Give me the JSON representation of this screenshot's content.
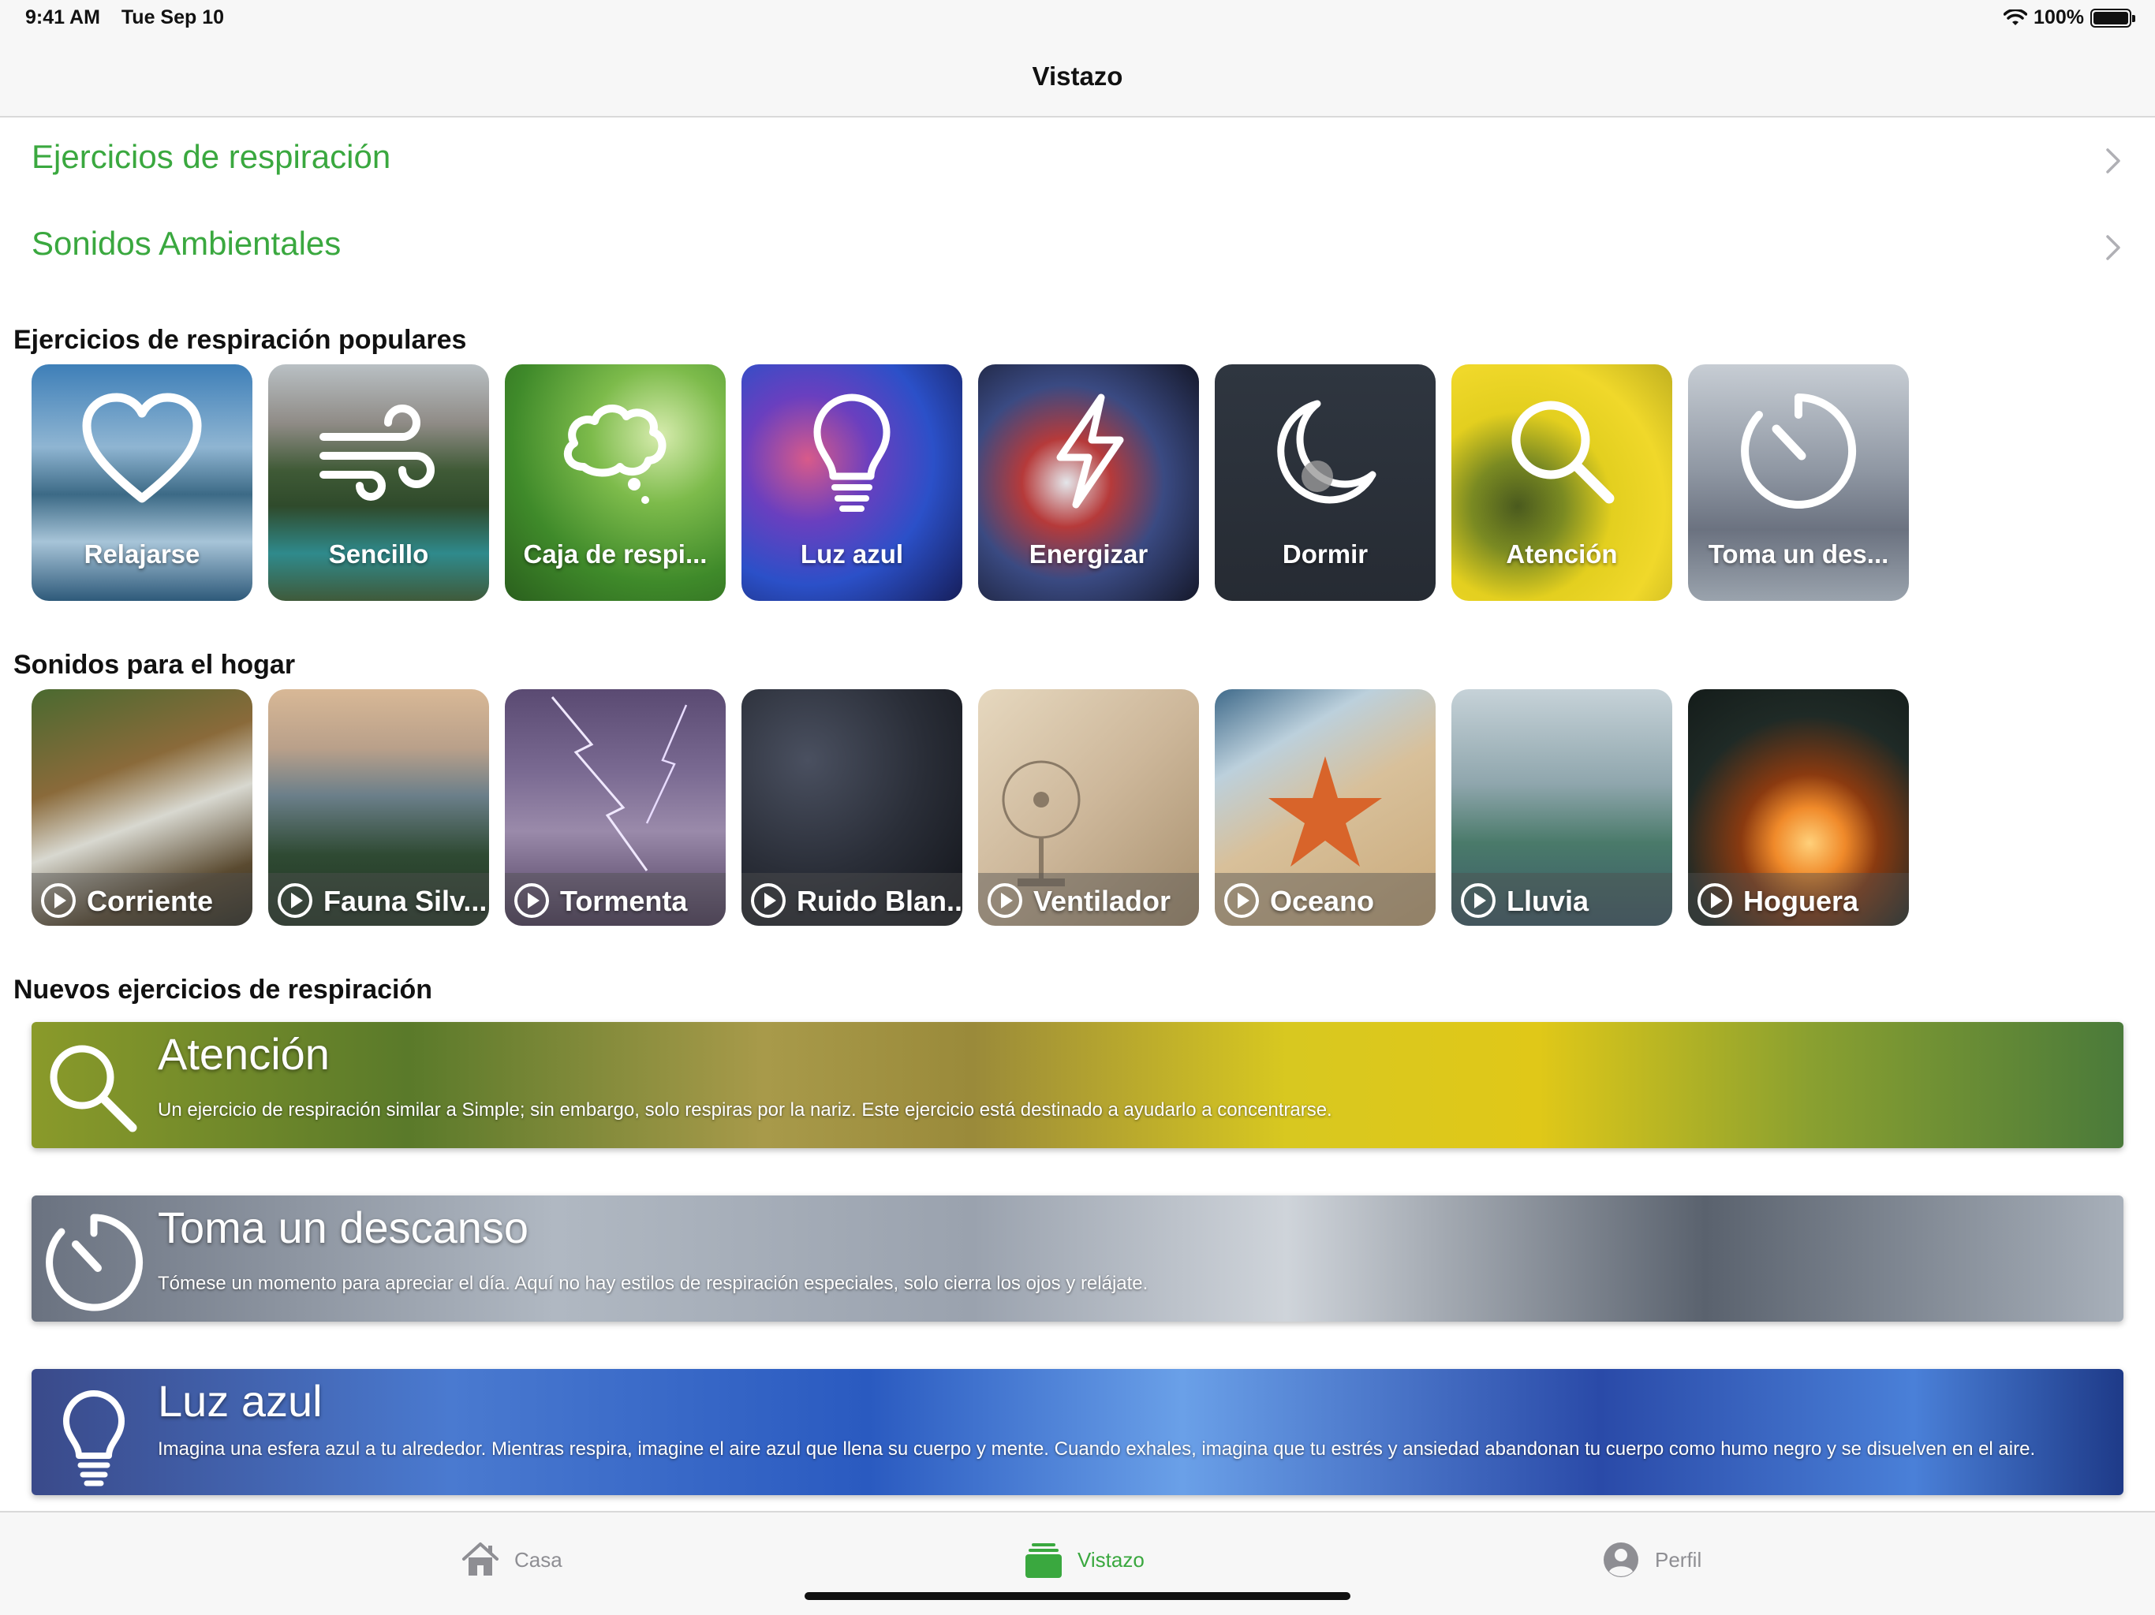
{
  "status_bar": {
    "time": "9:41 AM",
    "date": "Tue Sep 10",
    "battery": "100%"
  },
  "nav": {
    "title": "Vistazo"
  },
  "links": [
    {
      "label": "Ejercicios de respiración"
    },
    {
      "label": "Sonidos Ambientales"
    }
  ],
  "popular": {
    "title": "Ejercicios de respiración populares",
    "items": [
      {
        "label": "Relajarse",
        "icon": "heart-icon"
      },
      {
        "label": "Sencillo",
        "icon": "wind-icon"
      },
      {
        "label": "Caja de respi...",
        "icon": "thought-bubble-icon"
      },
      {
        "label": "Luz azul",
        "icon": "lightbulb-icon"
      },
      {
        "label": "Energizar",
        "icon": "lightning-icon"
      },
      {
        "label": "Dormir",
        "icon": "moon-icon"
      },
      {
        "label": "Atención",
        "icon": "magnifier-icon"
      },
      {
        "label": "Toma un des...",
        "icon": "timer-icon"
      }
    ]
  },
  "sounds": {
    "title": "Sonidos para el hogar",
    "items": [
      {
        "label": "Corriente"
      },
      {
        "label": "Fauna Silv..."
      },
      {
        "label": "Tormenta"
      },
      {
        "label": "Ruido Blan..."
      },
      {
        "label": "Ventilador"
      },
      {
        "label": "Oceano"
      },
      {
        "label": "Lluvia"
      },
      {
        "label": "Hoguera"
      }
    ]
  },
  "new_exercises": {
    "title": "Nuevos ejercicios de respiración",
    "items": [
      {
        "title": "Atención",
        "icon": "magnifier-icon",
        "description": "Un ejercicio de respiración similar a Simple; sin embargo, solo respiras por la nariz. Este ejercicio está destinado a ayudarlo a concentrarse."
      },
      {
        "title": "Toma un descanso",
        "icon": "timer-icon",
        "description": "Tómese un momento para apreciar el día. Aquí no hay estilos de respiración especiales, solo cierra los ojos y relájate."
      },
      {
        "title": "Luz azul",
        "icon": "lightbulb-icon",
        "description": "Imagina una esfera azul a tu alrededor. Mientras respira, imagine el aire azul que llena su cuerpo y mente. Cuando exhales, imagina que tu estrés y ansiedad abandonan tu cuerpo como humo negro y se disuelven en el aire."
      }
    ]
  },
  "tab_bar": {
    "tabs": [
      {
        "label": "Casa",
        "icon": "house-icon"
      },
      {
        "label": "Vistazo",
        "icon": "stack-icon",
        "active": true
      },
      {
        "label": "Perfil",
        "icon": "person-circle-icon"
      }
    ]
  },
  "colors": {
    "accent": "#3aa83f",
    "inactive": "#8e8e93"
  }
}
